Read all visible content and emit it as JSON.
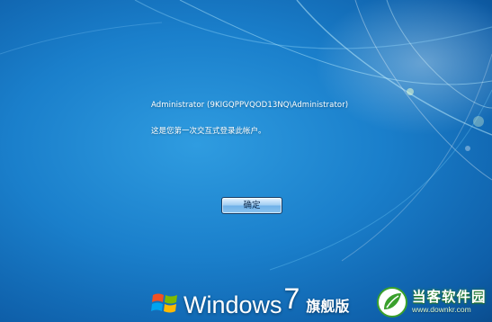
{
  "message": {
    "account": "Administrator (9KIGQPPVQOD13NQ\\Administrator)",
    "notice": "这是您第一次交互式登录此帐户。"
  },
  "button": {
    "ok_label": "确定"
  },
  "branding": {
    "product": "Windows",
    "version": "7",
    "edition": "旗舰版",
    "logo_icon": "windows-flag-icon"
  },
  "watermark": {
    "name": "当客软件园",
    "url": "www.downkr.com",
    "logo_icon": "downkr-logo-icon"
  },
  "colors": {
    "background": "#1a7fcb",
    "button_border": "#1b3f66",
    "text": "#ffffff"
  }
}
